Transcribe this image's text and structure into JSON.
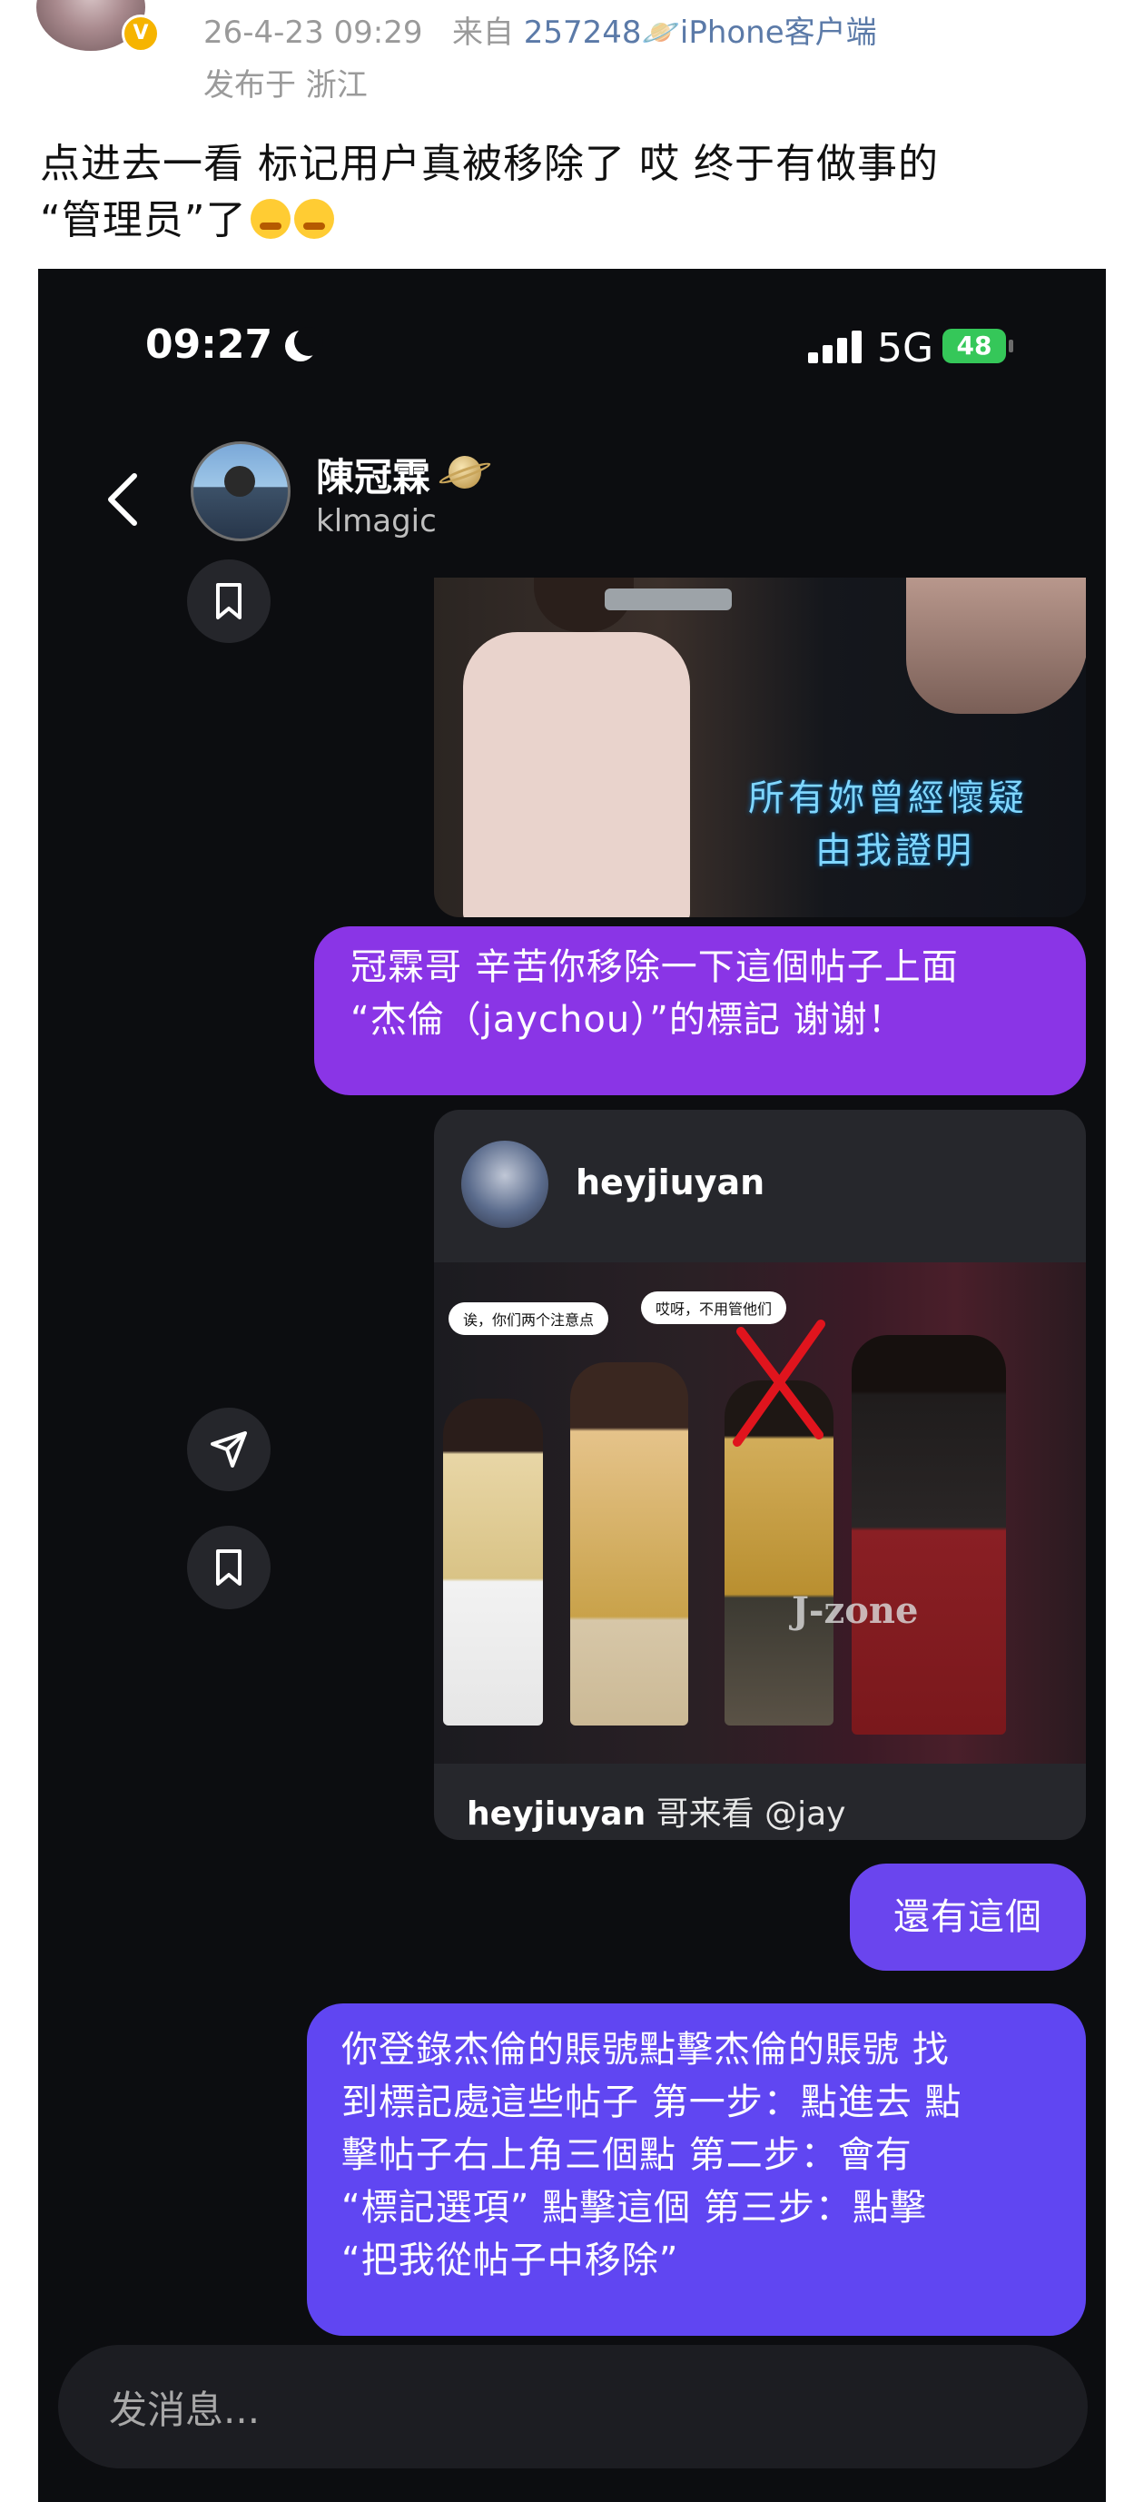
{
  "weibo": {
    "datetime": "26-4-23 09:29",
    "from_prefix": "来自",
    "source": "257248🪐iPhone客户端",
    "location": "发布于 浙江",
    "post_line1": "点进去一看 标记用户真被移除了 哎 终于有做事的",
    "post_line2": "“管理员”了"
  },
  "screenshot": {
    "status": {
      "time": "09:27",
      "network": "5G",
      "battery": "48"
    },
    "chat": {
      "name": "陳冠霖",
      "username": "klmagic"
    },
    "lyric_line1": "所有妳曾經懷疑",
    "lyric_line2": "由我證明",
    "messages": [
      {
        "line1": "冠霖哥 辛苦你移除一下這個帖子上面",
        "line2": "“杰倫（jaychou）”的標記 谢谢！"
      },
      {
        "text": "還有這個"
      },
      {
        "lines": [
          "你登錄杰倫的賬號點擊杰倫的賬號 找",
          "到標記處這些帖子 第一步：點進去 點",
          "擊帖子右上角三個點 第二步：會有",
          "“標記選項” 點擊這個 第三步：點擊",
          "“把我從帖子中移除”"
        ]
      }
    ],
    "shared_post": {
      "username": "heyjiuyan",
      "caption_user": "heyjiuyan",
      "caption_text": " 哥来看 @jay",
      "speech1": "诶，你们两个注意点",
      "speech2": "哎呀，不用管他们",
      "watermark": "J-zone"
    },
    "input_placeholder": "发消息..."
  },
  "icons": {
    "back": "chevron-left-icon",
    "share": "send-icon",
    "save": "bookmark-icon",
    "verified": "verified-badge-icon",
    "moon": "moon-icon",
    "signal": "signal-icon"
  },
  "colors": {
    "bubble_purple": "#8a35e6",
    "bubble_violet": "#6a45ee",
    "bubble_indigo": "#6046f2",
    "battery_green": "#35c759",
    "weibo_badge": "#f6b400"
  }
}
